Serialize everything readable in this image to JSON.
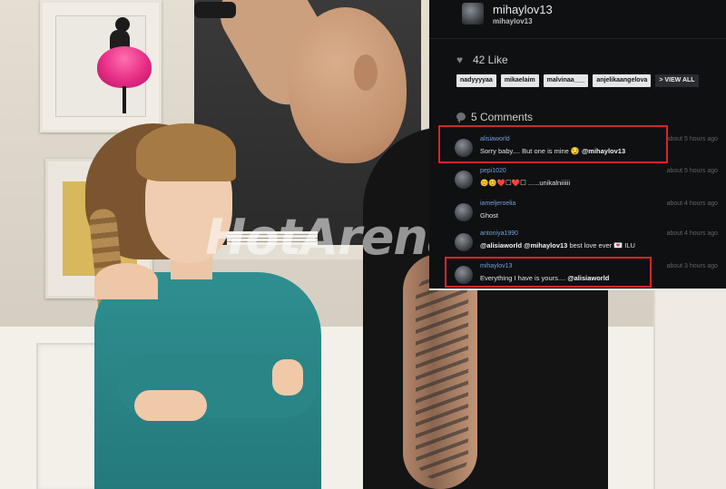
{
  "header": {
    "username": "mihaylov13",
    "subname": "mihaylov13"
  },
  "likes": {
    "count_label": "42 Like",
    "likers": [
      "nadyyyyaa",
      "mikaelaim",
      "malvinaa___",
      "anjelikaangelova"
    ],
    "view_all_label": "> VIEW ALL",
    "icon": "heart-icon"
  },
  "comments": {
    "title": "5 Comments",
    "icon": "speech-bubble-icon",
    "items": [
      {
        "user": "alisiaworld",
        "time": "about 5 hours ago",
        "text": "Sorry baby.... But one is mine",
        "emoji": "😏",
        "mention": "@mihaylov13"
      },
      {
        "user": "pepi1020",
        "time": "about 5 hours ago",
        "text": "😊😊❤️☐❤️☐ ......unikalniiiiii"
      },
      {
        "user": "iameljeroelia",
        "time": "about 4 hours ago",
        "text": "Ghost"
      },
      {
        "user": "antoniya1990",
        "time": "about 4 hours ago",
        "mention1": "@alisiaworld",
        "mention2": "@mihaylov13",
        "text": "best love ever",
        "emoji": "💌",
        "tail": "ILU"
      },
      {
        "user": "mihaylov13",
        "time": "about 3 hours ago",
        "text": "Everything I have is yours....",
        "mention": "@alisiaworld"
      }
    ]
  },
  "watermark": "HotArena.net",
  "colors": {
    "panel_bg": "#0f1012",
    "username_blue": "#6fa0d8",
    "highlight_red": "#d6252a"
  }
}
